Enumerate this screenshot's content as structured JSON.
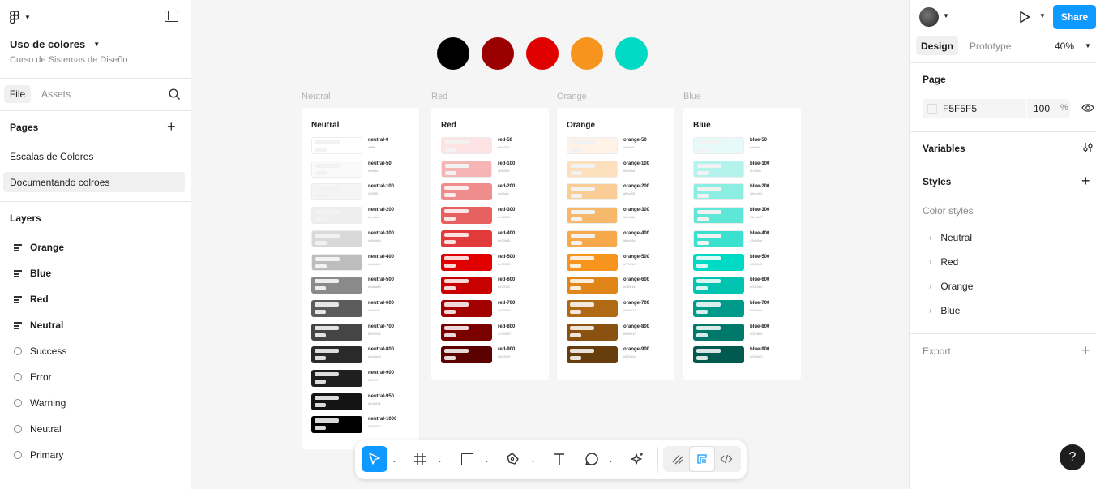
{
  "left": {
    "file_title": "Uso de colores",
    "project": "Curso de Sistemas de Diseño",
    "tabs": {
      "file": "File",
      "assets": "Assets"
    },
    "pages_heading": "Pages",
    "pages": [
      "Escalas de Colores",
      "Documentando colroes"
    ],
    "layers_heading": "Layers",
    "layers": [
      {
        "name": "Orange",
        "type": "frame"
      },
      {
        "name": "Blue",
        "type": "frame"
      },
      {
        "name": "Red",
        "type": "frame"
      },
      {
        "name": "Neutral",
        "type": "frame"
      },
      {
        "name": "Success",
        "type": "circle"
      },
      {
        "name": "Error",
        "type": "circle"
      },
      {
        "name": "Warning",
        "type": "circle"
      },
      {
        "name": "Neutral",
        "type": "circle"
      },
      {
        "name": "Primary",
        "type": "circle"
      }
    ]
  },
  "canvas": {
    "circles": [
      "#000000",
      "#9b0000",
      "#e00000",
      "#f7941d",
      "#00d9c3"
    ],
    "frame_labels": [
      "Neutral",
      "Red",
      "Orange",
      "Blue"
    ],
    "cards": [
      {
        "title": "Neutral",
        "swatches": [
          {
            "name": "neutral-0",
            "color": "#ffffff"
          },
          {
            "name": "neutral-50",
            "color": "#fafafa"
          },
          {
            "name": "neutral-100",
            "color": "#f5f5f5"
          },
          {
            "name": "neutral-200",
            "color": "#eeeeee"
          },
          {
            "name": "neutral-300",
            "color": "#d9d9d9"
          },
          {
            "name": "neutral-400",
            "color": "#bdbdbd"
          },
          {
            "name": "neutral-500",
            "color": "#8a8a8a"
          },
          {
            "name": "neutral-600",
            "color": "#5c5c5c"
          },
          {
            "name": "neutral-700",
            "color": "#454545"
          },
          {
            "name": "neutral-800",
            "color": "#2a2a2a"
          },
          {
            "name": "neutral-900",
            "color": "#1f1f1f"
          },
          {
            "name": "neutral-950",
            "color": "#141414"
          },
          {
            "name": "neutral-1000",
            "color": "#000000"
          }
        ]
      },
      {
        "title": "Red",
        "swatches": [
          {
            "name": "red-50",
            "color": "#fde3e3"
          },
          {
            "name": "red-100",
            "color": "#f5b5b5"
          },
          {
            "name": "red-200",
            "color": "#ef8c8c"
          },
          {
            "name": "red-300",
            "color": "#e86161"
          },
          {
            "name": "red-400",
            "color": "#e33b3b"
          },
          {
            "name": "red-500",
            "color": "#e00000"
          },
          {
            "name": "red-600",
            "color": "#c90000"
          },
          {
            "name": "red-700",
            "color": "#a30000"
          },
          {
            "name": "red-800",
            "color": "#7a0000"
          },
          {
            "name": "red-900",
            "color": "#5c0000"
          }
        ]
      },
      {
        "title": "Orange",
        "swatches": [
          {
            "name": "orange-50",
            "color": "#fef3e6"
          },
          {
            "name": "orange-100",
            "color": "#fce0bd"
          },
          {
            "name": "orange-200",
            "color": "#f9cd95"
          },
          {
            "name": "orange-300",
            "color": "#f6b86b"
          },
          {
            "name": "orange-400",
            "color": "#f6a94a"
          },
          {
            "name": "orange-500",
            "color": "#f7941d"
          },
          {
            "name": "orange-600",
            "color": "#df851a"
          },
          {
            "name": "orange-700",
            "color": "#b06914"
          },
          {
            "name": "orange-800",
            "color": "#8a5210"
          },
          {
            "name": "orange-900",
            "color": "#663d0c"
          }
        ]
      },
      {
        "title": "Blue",
        "swatches": [
          {
            "name": "blue-50",
            "color": "#e6fbf9"
          },
          {
            "name": "blue-100",
            "color": "#b4f3ec"
          },
          {
            "name": "blue-200",
            "color": "#8cede2"
          },
          {
            "name": "blue-300",
            "color": "#5ee6d7"
          },
          {
            "name": "blue-400",
            "color": "#3be0ce"
          },
          {
            "name": "blue-500",
            "color": "#00d9c3"
          },
          {
            "name": "blue-600",
            "color": "#00c4b0"
          },
          {
            "name": "blue-700",
            "color": "#009a8a"
          },
          {
            "name": "blue-800",
            "color": "#00786b"
          },
          {
            "name": "blue-900",
            "color": "#005a50"
          }
        ]
      }
    ]
  },
  "right": {
    "share": "Share",
    "tabs": {
      "design": "Design",
      "prototype": "Prototype"
    },
    "zoom": "40%",
    "page_heading": "Page",
    "page_color": "F5F5F5",
    "page_opacity": "100",
    "percent": "%",
    "variables": "Variables",
    "styles": "Styles",
    "color_styles": "Color styles",
    "style_items": [
      "Neutral",
      "Red",
      "Orange",
      "Blue"
    ],
    "export": "Export"
  },
  "help": "?",
  "colors": {
    "accent": "#0d99ff",
    "selected_page": "#f0f0f0"
  }
}
